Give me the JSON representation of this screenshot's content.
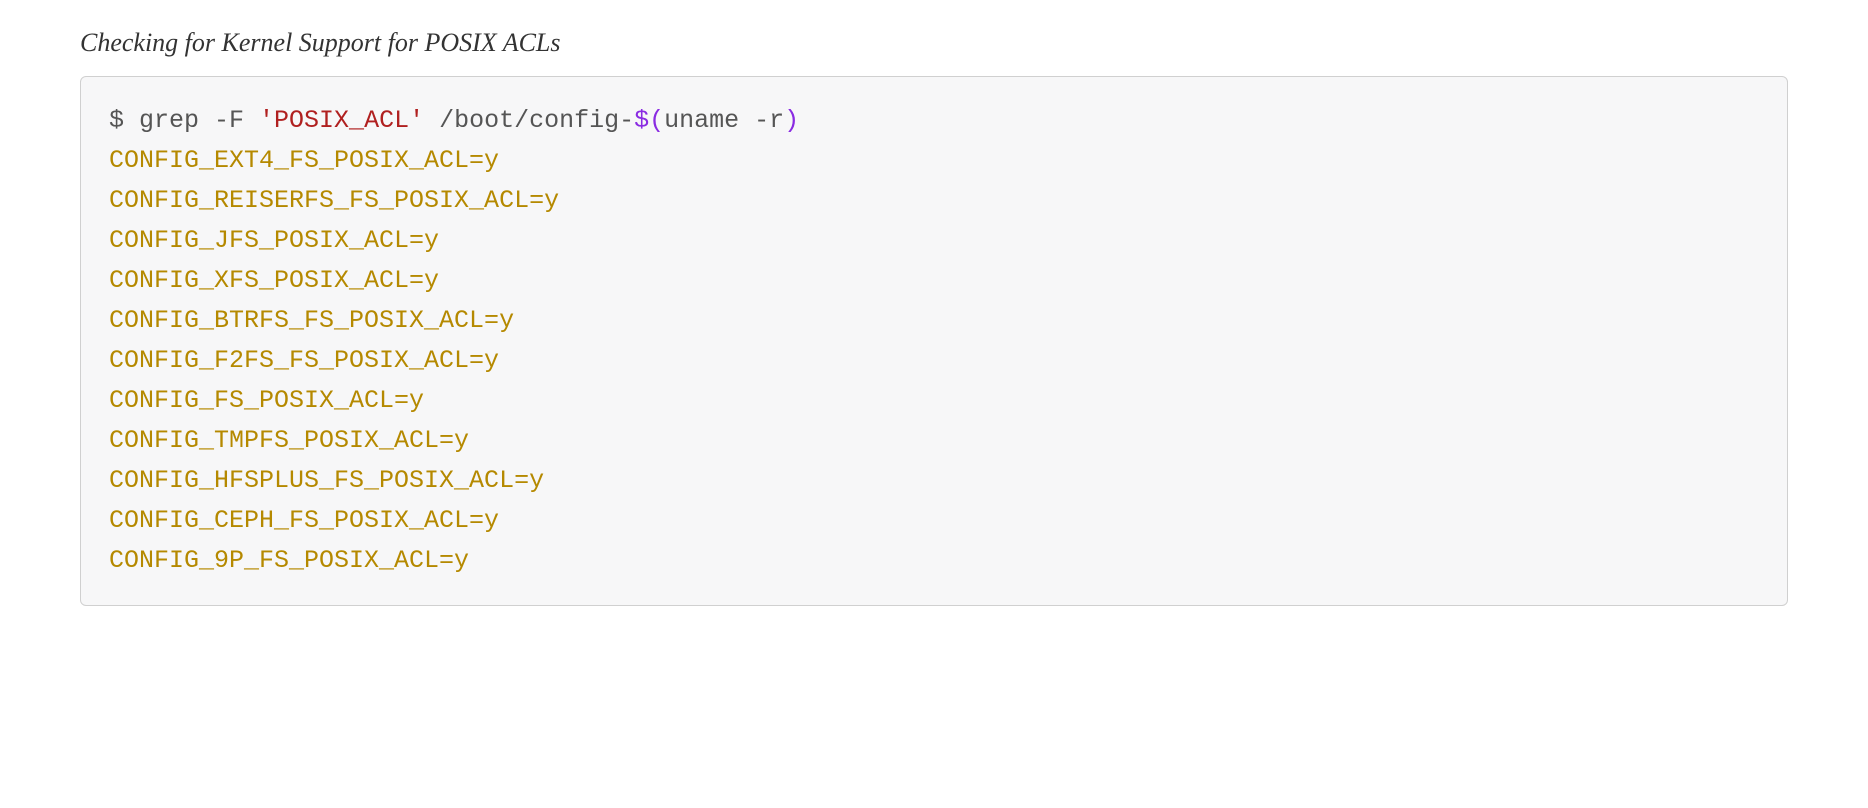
{
  "caption": "Checking for Kernel Support for POSIX ACLs",
  "command": {
    "prompt": "$ ",
    "cmd1": "grep -F ",
    "string": "'POSIX_ACL'",
    "cmd2": " /boot/config-",
    "subst_open": "$(",
    "subst_body": "uname -r",
    "subst_close": ")"
  },
  "output": [
    "CONFIG_EXT4_FS_POSIX_ACL=y",
    "CONFIG_REISERFS_FS_POSIX_ACL=y",
    "CONFIG_JFS_POSIX_ACL=y",
    "CONFIG_XFS_POSIX_ACL=y",
    "CONFIG_BTRFS_FS_POSIX_ACL=y",
    "CONFIG_F2FS_FS_POSIX_ACL=y",
    "CONFIG_FS_POSIX_ACL=y",
    "CONFIG_TMPFS_POSIX_ACL=y",
    "CONFIG_HFSPLUS_FS_POSIX_ACL=y",
    "CONFIG_CEPH_FS_POSIX_ACL=y",
    "CONFIG_9P_FS_POSIX_ACL=y"
  ]
}
